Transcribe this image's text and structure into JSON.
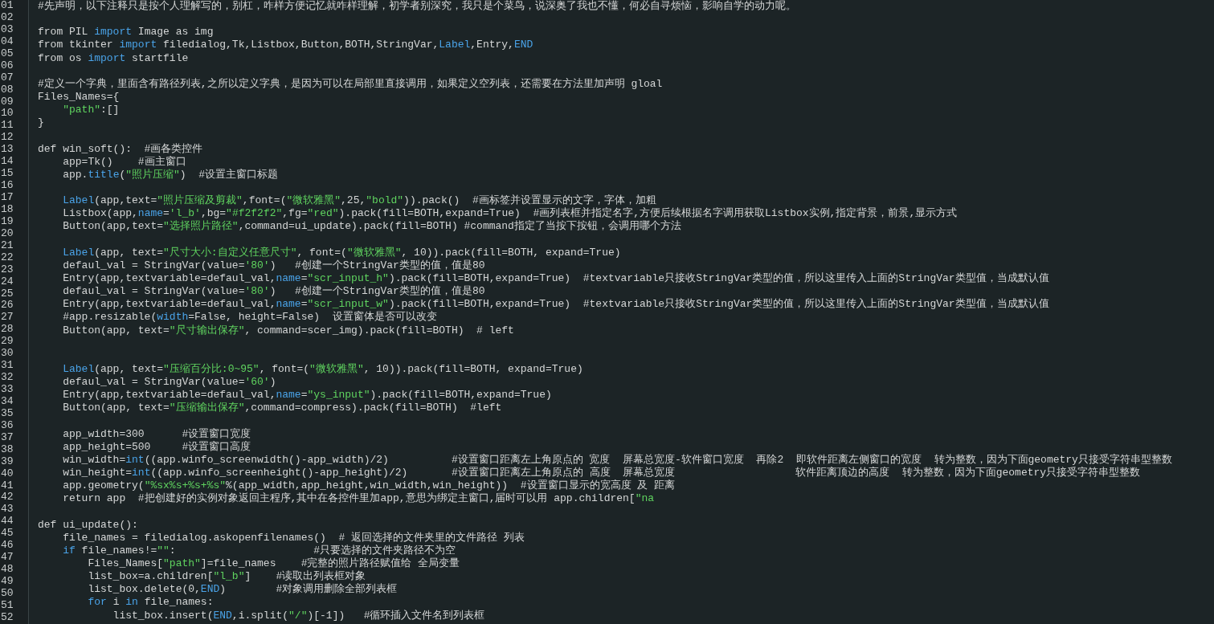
{
  "gutter": [
    "01",
    "02",
    "03",
    "04",
    "05",
    "06",
    "07",
    "08",
    "09",
    "10",
    "11",
    "12",
    "13",
    "14",
    "15",
    "16",
    "17",
    "18",
    "19",
    "20",
    "21",
    "22",
    "23",
    "24",
    "25",
    "26",
    "27",
    "28",
    "29",
    "30",
    "31",
    "32",
    "33",
    "34",
    "35",
    "36",
    "37",
    "38",
    "39",
    "40",
    "41",
    "42",
    "43",
    "44",
    "45",
    "46",
    "47",
    "48",
    "49",
    "50",
    "51",
    "52"
  ],
  "lines": [
    {
      "kind": "code",
      "tokens": [
        {
          "kind": "text",
          "text": "#先声明，以下注释只是按个人理解写的，别杠，咋样方便记忆就咋样理解，初学者别深究，我只是个菜鸟，说深奥了我也不懂，何必自寻烦恼，影响自学的动力呢。"
        }
      ]
    },
    {
      "kind": "blank"
    },
    {
      "kind": "code",
      "tokens": [
        {
          "kind": "text",
          "text": "from PIL "
        },
        {
          "kind": "kw",
          "text": "import"
        },
        {
          "kind": "text",
          "text": " Image as img"
        }
      ]
    },
    {
      "kind": "code",
      "tokens": [
        {
          "kind": "text",
          "text": "from tkinter "
        },
        {
          "kind": "kw",
          "text": "import"
        },
        {
          "kind": "text",
          "text": " filedialog,Tk,Listbox,Button,BOTH,StringVar,"
        },
        {
          "kind": "kw",
          "text": "Label"
        },
        {
          "kind": "text",
          "text": ",Entry,"
        },
        {
          "kind": "kw",
          "text": "END"
        }
      ]
    },
    {
      "kind": "code",
      "tokens": [
        {
          "kind": "text",
          "text": "from os "
        },
        {
          "kind": "kw",
          "text": "import"
        },
        {
          "kind": "text",
          "text": " startfile"
        }
      ]
    },
    {
      "kind": "blank"
    },
    {
      "kind": "code",
      "tokens": [
        {
          "kind": "text",
          "text": "#定义一个字典，里面含有路径列表,之所以定义字典，是因为可以在局部里直接调用，如果定义空列表，还需要在方法里加声明 gloal"
        }
      ]
    },
    {
      "kind": "code",
      "tokens": [
        {
          "kind": "text",
          "text": "Files_Names={"
        }
      ]
    },
    {
      "kind": "code",
      "tokens": [
        {
          "kind": "str",
          "text": "    \"path\""
        },
        {
          "kind": "text",
          "text": ":[]"
        }
      ]
    },
    {
      "kind": "code",
      "tokens": [
        {
          "kind": "text",
          "text": "}"
        }
      ]
    },
    {
      "kind": "blank"
    },
    {
      "kind": "code",
      "tokens": [
        {
          "kind": "text",
          "text": "def win_soft():  #画各类控件"
        }
      ]
    },
    {
      "kind": "code",
      "tokens": [
        {
          "kind": "text",
          "text": "    app=Tk()    #画主窗口"
        }
      ]
    },
    {
      "kind": "code",
      "tokens": [
        {
          "kind": "text",
          "text": "    app."
        },
        {
          "kind": "kw",
          "text": "title"
        },
        {
          "kind": "text",
          "text": "("
        },
        {
          "kind": "str",
          "text": "\"照片压缩\""
        },
        {
          "kind": "text",
          "text": ")  #设置主窗口标题"
        }
      ]
    },
    {
      "kind": "blank"
    },
    {
      "kind": "code",
      "tokens": [
        {
          "kind": "kw",
          "text": "    Label"
        },
        {
          "kind": "text",
          "text": "(app,text="
        },
        {
          "kind": "str",
          "text": "\"照片压缩及剪裁\""
        },
        {
          "kind": "text",
          "text": ",font=("
        },
        {
          "kind": "str",
          "text": "\"微软雅黑\""
        },
        {
          "kind": "text",
          "text": ",25,"
        },
        {
          "kind": "str",
          "text": "\"bold\""
        },
        {
          "kind": "text",
          "text": ")).pack()  #画标签并设置显示的文字，字体，加粗"
        }
      ]
    },
    {
      "kind": "code",
      "tokens": [
        {
          "kind": "text",
          "text": "    Listbox(app,"
        },
        {
          "kind": "kw",
          "text": "name"
        },
        {
          "kind": "text",
          "text": "="
        },
        {
          "kind": "str",
          "text": "'l_b'"
        },
        {
          "kind": "text",
          "text": ",bg="
        },
        {
          "kind": "str",
          "text": "\"#f2f2f2\""
        },
        {
          "kind": "text",
          "text": ",fg="
        },
        {
          "kind": "str",
          "text": "\"red\""
        },
        {
          "kind": "text",
          "text": ").pack(fill=BOTH,expand=True)  #画列表框并指定名字,方便后续根据名字调用获取Listbox实例,指定背景，前景,显示方式"
        }
      ]
    },
    {
      "kind": "code",
      "tokens": [
        {
          "kind": "text",
          "text": "    Button(app,text="
        },
        {
          "kind": "str",
          "text": "\"选择照片路径\""
        },
        {
          "kind": "text",
          "text": ",command=ui_update).pack(fill=BOTH) #command指定了当按下按钮，会调用哪个方法"
        }
      ]
    },
    {
      "kind": "blank"
    },
    {
      "kind": "code",
      "tokens": [
        {
          "kind": "kw",
          "text": "    Label"
        },
        {
          "kind": "text",
          "text": "(app, text="
        },
        {
          "kind": "str",
          "text": "\"尺寸大小:自定义任意尺寸\""
        },
        {
          "kind": "text",
          "text": ", font=("
        },
        {
          "kind": "str",
          "text": "\"微软雅黑\""
        },
        {
          "kind": "text",
          "text": ", 10)).pack(fill=BOTH, expand=True)"
        }
      ]
    },
    {
      "kind": "code",
      "tokens": [
        {
          "kind": "text",
          "text": "    defaul_val = StringVar(value="
        },
        {
          "kind": "str",
          "text": "'80'"
        },
        {
          "kind": "text",
          "text": ")   #创建一个StringVar类型的值，值是80"
        }
      ]
    },
    {
      "kind": "code",
      "tokens": [
        {
          "kind": "text",
          "text": "    Entry(app,textvariable=defaul_val,"
        },
        {
          "kind": "kw",
          "text": "name"
        },
        {
          "kind": "text",
          "text": "="
        },
        {
          "kind": "str",
          "text": "\"scr_input_h\""
        },
        {
          "kind": "text",
          "text": ").pack(fill=BOTH,expand=True)  #textvariable只接收StringVar类型的值，所以这里传入上面的StringVar类型值，当成默认值"
        }
      ]
    },
    {
      "kind": "code",
      "tokens": [
        {
          "kind": "text",
          "text": "    defaul_val = StringVar(value="
        },
        {
          "kind": "str",
          "text": "'80'"
        },
        {
          "kind": "text",
          "text": ")   #创建一个StringVar类型的值，值是80"
        }
      ]
    },
    {
      "kind": "code",
      "tokens": [
        {
          "kind": "text",
          "text": "    Entry(app,textvariable=defaul_val,"
        },
        {
          "kind": "kw",
          "text": "name"
        },
        {
          "kind": "text",
          "text": "="
        },
        {
          "kind": "str",
          "text": "\"scr_input_w\""
        },
        {
          "kind": "text",
          "text": ").pack(fill=BOTH,expand=True)  #textvariable只接收StringVar类型的值，所以这里传入上面的StringVar类型值，当成默认值"
        }
      ]
    },
    {
      "kind": "code",
      "tokens": [
        {
          "kind": "text",
          "text": "    #app.resizable("
        },
        {
          "kind": "kw",
          "text": "width"
        },
        {
          "kind": "text",
          "text": "=False, height=False)  设置窗体是否可以改变"
        }
      ]
    },
    {
      "kind": "code",
      "tokens": [
        {
          "kind": "text",
          "text": "    Button(app, text="
        },
        {
          "kind": "str",
          "text": "\"尺寸输出保存\""
        },
        {
          "kind": "text",
          "text": ", command=scer_img).pack(fill=BOTH)  # left"
        }
      ]
    },
    {
      "kind": "blank"
    },
    {
      "kind": "blank"
    },
    {
      "kind": "code",
      "tokens": [
        {
          "kind": "kw",
          "text": "    Label"
        },
        {
          "kind": "text",
          "text": "(app, text="
        },
        {
          "kind": "str",
          "text": "\"压缩百分比:0~95\""
        },
        {
          "kind": "text",
          "text": ", font=("
        },
        {
          "kind": "str",
          "text": "\"微软雅黑\""
        },
        {
          "kind": "text",
          "text": ", 10)).pack(fill=BOTH, expand=True)"
        }
      ]
    },
    {
      "kind": "code",
      "tokens": [
        {
          "kind": "text",
          "text": "    defaul_val = StringVar(value="
        },
        {
          "kind": "str",
          "text": "'60'"
        },
        {
          "kind": "text",
          "text": ")"
        }
      ]
    },
    {
      "kind": "code",
      "tokens": [
        {
          "kind": "text",
          "text": "    Entry(app,textvariable=defaul_val,"
        },
        {
          "kind": "kw",
          "text": "name"
        },
        {
          "kind": "text",
          "text": "="
        },
        {
          "kind": "str",
          "text": "\"ys_input\""
        },
        {
          "kind": "text",
          "text": ").pack(fill=BOTH,expand=True)"
        }
      ]
    },
    {
      "kind": "code",
      "tokens": [
        {
          "kind": "text",
          "text": "    Button(app, text="
        },
        {
          "kind": "str",
          "text": "\"压缩输出保存\""
        },
        {
          "kind": "text",
          "text": ",command=compress).pack(fill=BOTH)  #left"
        }
      ]
    },
    {
      "kind": "blank"
    },
    {
      "kind": "code",
      "tokens": [
        {
          "kind": "text",
          "text": "    app_width=300      #设置窗口宽度"
        }
      ]
    },
    {
      "kind": "code",
      "tokens": [
        {
          "kind": "text",
          "text": "    app_height=500     #设置窗口高度"
        }
      ]
    },
    {
      "kind": "code",
      "tokens": [
        {
          "kind": "text",
          "text": "    win_width="
        },
        {
          "kind": "kw",
          "text": "int"
        },
        {
          "kind": "text",
          "text": "((app.winfo_screenwidth()-app_width)/2)          #设置窗口距离左上角原点的 宽度  屏幕总宽度-软件窗口宽度  再除2  即软件距离左侧窗口的宽度  转为整数，因为下面geometry只接受字符串型整数"
        }
      ]
    },
    {
      "kind": "code",
      "tokens": [
        {
          "kind": "text",
          "text": "    win_height="
        },
        {
          "kind": "kw",
          "text": "int"
        },
        {
          "kind": "text",
          "text": "((app.winfo_screenheight()-app_height)/2)       #设置窗口距离左上角原点的 高度  屏幕总宽度"
        },
        {
          "kind": "gap"
        },
        {
          "kind": "text",
          "text": "软件距离顶边的高度  转为整数，因为下面geometry只接受字符串型整数"
        }
      ]
    },
    {
      "kind": "code",
      "tokens": [
        {
          "kind": "text",
          "text": "    app.geometry("
        },
        {
          "kind": "str",
          "text": "\"%sx%s+%s+%s\""
        },
        {
          "kind": "text",
          "text": "%(app_width,app_height,win_width,win_height))  #设置窗口显示的宽高度 及 距离"
        }
      ]
    },
    {
      "kind": "code",
      "tokens": [
        {
          "kind": "text",
          "text": "    return app  #把创建好的实例对象返回主程序,其中在各控件里加app,意思为绑定主窗口,届时可以用 app.children["
        },
        {
          "kind": "str",
          "text": "\"na"
        }
      ]
    },
    {
      "kind": "blank"
    },
    {
      "kind": "code",
      "tokens": [
        {
          "kind": "text",
          "text": "def ui_update():"
        }
      ]
    },
    {
      "kind": "code",
      "tokens": [
        {
          "kind": "text",
          "text": "    file_names = filedialog.askopenfilenames()  # 返回选择的文件夹里的文件路径 列表"
        }
      ]
    },
    {
      "kind": "code",
      "tokens": [
        {
          "kind": "kw",
          "text": "    if"
        },
        {
          "kind": "text",
          "text": " file_names!="
        },
        {
          "kind": "str",
          "text": "\"\""
        },
        {
          "kind": "text",
          "text": ":                      #只要选择的文件夹路径不为空"
        }
      ]
    },
    {
      "kind": "code",
      "tokens": [
        {
          "kind": "text",
          "text": "        Files_Names["
        },
        {
          "kind": "str",
          "text": "\"path\""
        },
        {
          "kind": "text",
          "text": "]=file_names    #完整的照片路径赋值给 全局变量"
        }
      ]
    },
    {
      "kind": "code",
      "tokens": [
        {
          "kind": "text",
          "text": "        list_box=a.children["
        },
        {
          "kind": "str",
          "text": "\"l_b\""
        },
        {
          "kind": "text",
          "text": "]    #读取出列表框对象"
        }
      ]
    },
    {
      "kind": "code",
      "tokens": [
        {
          "kind": "text",
          "text": "        list_box.delete(0,"
        },
        {
          "kind": "kw",
          "text": "END"
        },
        {
          "kind": "text",
          "text": ")        #对象调用删除全部列表框"
        }
      ]
    },
    {
      "kind": "code",
      "tokens": [
        {
          "kind": "kw",
          "text": "        for"
        },
        {
          "kind": "text",
          "text": " i "
        },
        {
          "kind": "kw",
          "text": "in"
        },
        {
          "kind": "text",
          "text": " file_names:"
        }
      ]
    },
    {
      "kind": "code",
      "tokens": [
        {
          "kind": "text",
          "text": "            list_box.insert("
        },
        {
          "kind": "kw",
          "text": "END"
        },
        {
          "kind": "text",
          "text": ",i.split("
        },
        {
          "kind": "str",
          "text": "\"/\""
        },
        {
          "kind": "text",
          "text": ")[-1])   #循环插入文件名到列表框"
        }
      ]
    }
  ]
}
